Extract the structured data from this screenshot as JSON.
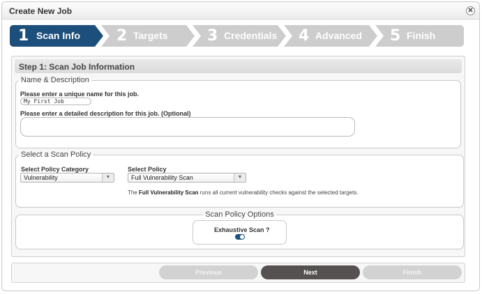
{
  "dialog": {
    "title": "Create New Job",
    "close_label": "✕"
  },
  "wizard": {
    "steps": [
      {
        "num": "1",
        "label": "Scan Info",
        "active": true
      },
      {
        "num": "2",
        "label": "Targets"
      },
      {
        "num": "3",
        "label": "Credentials"
      },
      {
        "num": "4",
        "label": "Advanced"
      },
      {
        "num": "5",
        "label": "Finish"
      }
    ]
  },
  "panel": {
    "header": "Step 1: Scan Job Information",
    "name_desc": {
      "legend": "Name & Description",
      "name_label": "Please enter a unique name for this job.",
      "name_value": "My First Job",
      "desc_label": "Please enter a detailed description for this job. (Optional)",
      "desc_value": ""
    },
    "policy": {
      "legend": "Select a Scan Policy",
      "category_label": "Select Policy Category",
      "category_value": "Vulnerability",
      "policy_label": "Select Policy",
      "policy_value": "Full Vulnerability Scan",
      "desc_prefix": "The",
      "desc_bold": "Full Vulnerability Scan",
      "desc_suffix": "runs all current vulnerability checks against the selected targets."
    },
    "options": {
      "legend": "Scan Policy Options",
      "exhaustive_label": "Exhaustive Scan ?",
      "exhaustive_on": true
    }
  },
  "footer": {
    "previous": "Previous",
    "next": "Next",
    "finish": "Finish"
  },
  "colors": {
    "active_step": "#1c4f7c",
    "inactive_step": "#cdcdcd",
    "primary_btn": "#555150"
  }
}
